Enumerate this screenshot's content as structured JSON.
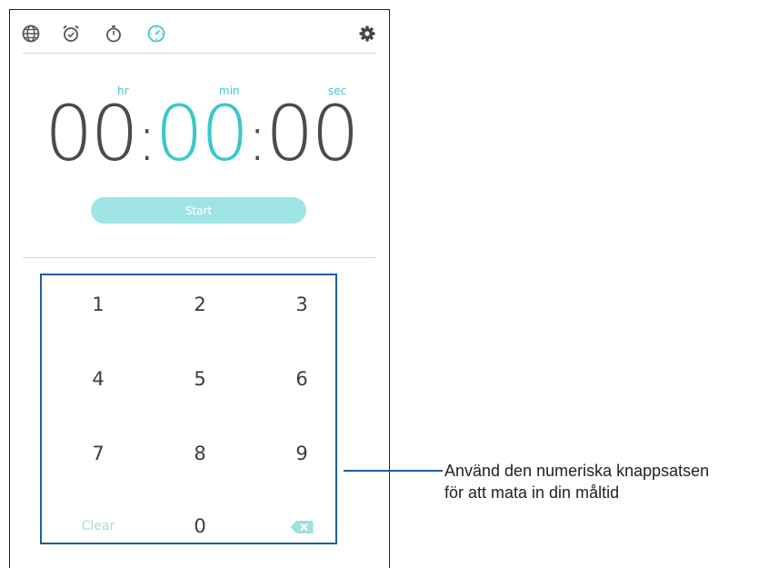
{
  "toolbar": {
    "icons": [
      "world-clock-icon",
      "alarm-icon",
      "stopwatch-icon",
      "timer-icon",
      "settings-gear-icon"
    ],
    "active_icon": "timer-icon"
  },
  "timer": {
    "hr_label": "hr",
    "min_label": "min",
    "sec_label": "sec",
    "hours": "00",
    "minutes": "00",
    "seconds": "00",
    "separator": ":"
  },
  "start_label": "Start",
  "keypad": {
    "k1": "1",
    "k2": "2",
    "k3": "3",
    "k4": "4",
    "k5": "5",
    "k6": "6",
    "k7": "7",
    "k8": "8",
    "k9": "9",
    "clear": "Clear",
    "k0": "0",
    "backspace": "backspace-icon"
  },
  "callout": {
    "line1": "Använd den numeriska knappsatsen",
    "line2": "för att mata in din måltid"
  },
  "colors": {
    "accent": "#3cc8cc",
    "start_button": "#9fe5e5",
    "callout_border": "#1f5fa0"
  }
}
